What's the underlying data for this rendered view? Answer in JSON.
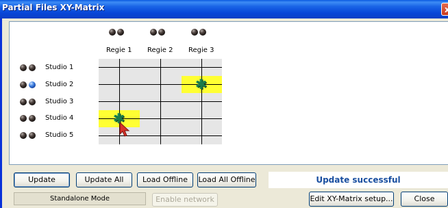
{
  "window": {
    "title": "Partial Files XY-Matrix",
    "close_glyph": "x"
  },
  "matrix": {
    "columns": [
      {
        "label": "Regie 1",
        "indicators": [
          "dark",
          "dark"
        ]
      },
      {
        "label": "Regie 2",
        "indicators": [
          "dark",
          "dark"
        ]
      },
      {
        "label": "Regie 3",
        "indicators": [
          "dark",
          "dark"
        ]
      }
    ],
    "rows": [
      {
        "label": "Studio 1",
        "indicators": [
          "dark",
          "dark"
        ]
      },
      {
        "label": "Studio 2",
        "indicators": [
          "dark",
          "blue"
        ]
      },
      {
        "label": "Studio 3",
        "indicators": [
          "dark",
          "dark"
        ]
      },
      {
        "label": "Studio 4",
        "indicators": [
          "dark",
          "dark"
        ]
      },
      {
        "label": "Studio 5",
        "indicators": [
          "dark",
          "dark"
        ]
      }
    ],
    "connections": [
      {
        "row": "Studio 2",
        "column": "Regie 3"
      },
      {
        "row": "Studio 4",
        "column": "Regie 1"
      }
    ],
    "highlight_color": "#ffff33",
    "connection_icon": "green-cross-icon"
  },
  "toolbar": {
    "update": "Update",
    "update_all": "Update All",
    "load_offline": "Load Offline",
    "load_all_offline": "Load All Offline",
    "status": "Update successful"
  },
  "footer": {
    "mode": "Standalone Mode",
    "enable_network": "Enable network",
    "edit_setup": "Edit XY-Matrix setup...",
    "close": "Close"
  },
  "colors": {
    "title_bar": "#0a46d8",
    "status_text": "#1a4fa0",
    "selected_indicator": "#3e7fe0"
  }
}
